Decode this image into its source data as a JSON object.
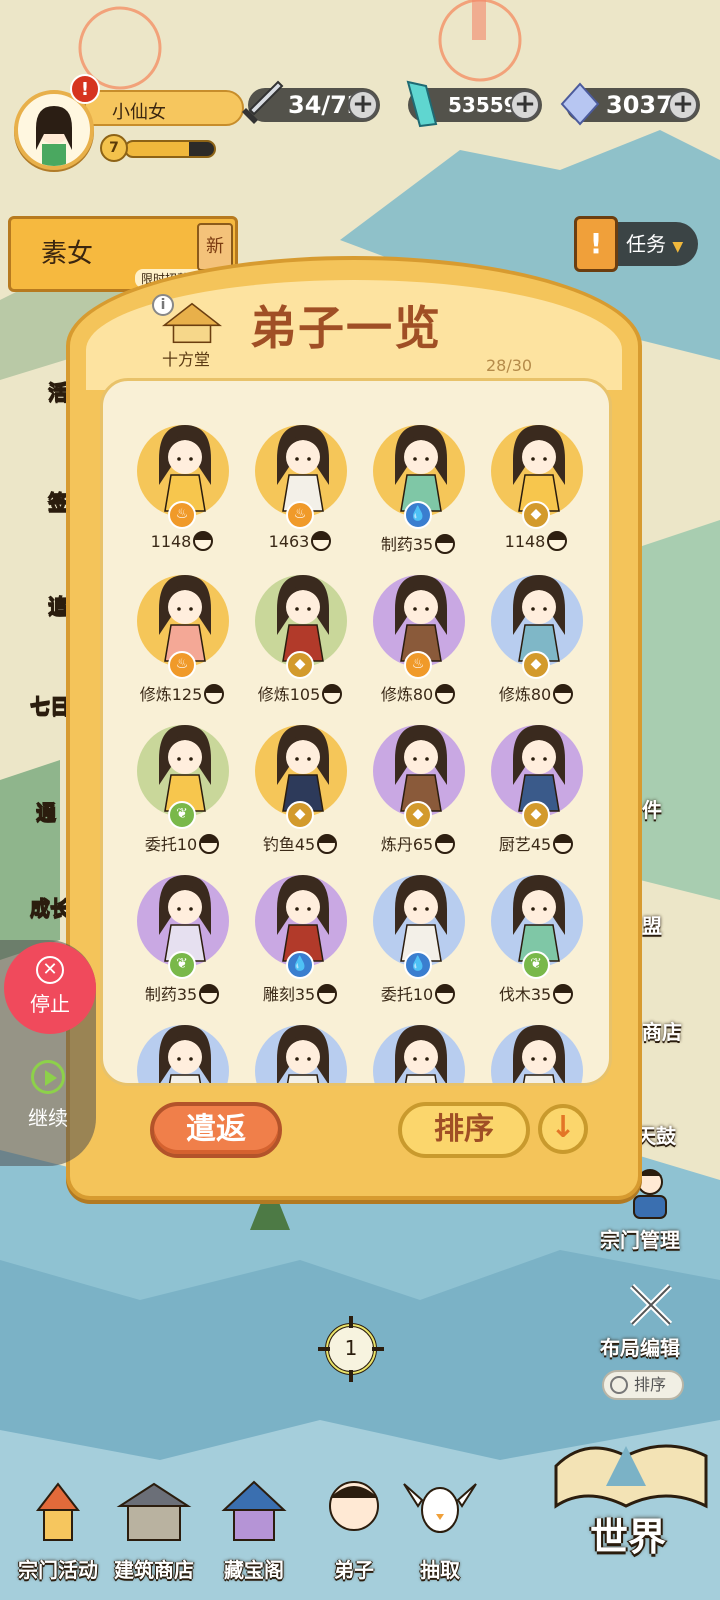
{
  "player": {
    "name": "小仙女",
    "level": "7",
    "exp_fraction": 0.72
  },
  "resources": [
    {
      "id": "stamina",
      "icon": "sword-icon",
      "value": "34/72"
    },
    {
      "id": "jade",
      "icon": "crystal-icon",
      "value": "535596"
    },
    {
      "id": "gem",
      "icon": "diamond-icon",
      "value": "3037"
    }
  ],
  "banner": {
    "title": "素女",
    "subtitle": "限时招募活动",
    "tag": "新"
  },
  "task": {
    "label": "任务"
  },
  "left_side_labels": [
    "活",
    "签",
    "追",
    "七日",
    "通",
    "成长"
  ],
  "panel": {
    "hall_label": "十方堂",
    "title": "弟子一览",
    "count": "28/30",
    "dismiss_label": "遣返",
    "sort_label": "排序"
  },
  "disciples": [
    {
      "label": "1148",
      "bg": "#f5c659",
      "elem": "fire",
      "elem_color": "#f09a2a",
      "robe": "#f7c64d"
    },
    {
      "label": "1463",
      "bg": "#f5c659",
      "elem": "fire",
      "elem_color": "#f09a2a",
      "robe": "#f3f0e8"
    },
    {
      "label": "制药35",
      "bg": "#f5c659",
      "elem": "water",
      "elem_color": "#3a7ecf",
      "robe": "#7fc7a6"
    },
    {
      "label": "1148",
      "bg": "#f5c659",
      "elem": "earth",
      "elem_color": "#d39a2c",
      "robe": "#f7c64d"
    },
    {
      "label": "修炼125",
      "bg": "#f5c659",
      "elem": "fire",
      "elem_color": "#f09a2a",
      "robe": "#f4a896"
    },
    {
      "label": "修炼105",
      "bg": "#c9d79a",
      "elem": "earth",
      "elem_color": "#d39a2c",
      "robe": "#b23a2a"
    },
    {
      "label": "修炼80",
      "bg": "#c9a8e3",
      "elem": "fire",
      "elem_color": "#f09a2a",
      "robe": "#8a5a3a"
    },
    {
      "label": "修炼80",
      "bg": "#b8cdef",
      "elem": "earth",
      "elem_color": "#d39a2c",
      "robe": "#7fb7c7"
    },
    {
      "label": "委托10",
      "bg": "#c9d79a",
      "elem": "wood",
      "elem_color": "#79b84a",
      "robe": "#f7c64d"
    },
    {
      "label": "钓鱼45",
      "bg": "#f5c659",
      "elem": "earth",
      "elem_color": "#d39a2c",
      "robe": "#2d3a5a"
    },
    {
      "label": "炼丹65",
      "bg": "#c9a8e3",
      "elem": "earth",
      "elem_color": "#d39a2c",
      "robe": "#8a5a3a"
    },
    {
      "label": "厨艺45",
      "bg": "#c9a8e3",
      "elem": "earth",
      "elem_color": "#d39a2c",
      "robe": "#3a5a8a"
    },
    {
      "label": "制药35",
      "bg": "#c9a8e3",
      "elem": "wood",
      "elem_color": "#79b84a",
      "robe": "#e6e0f0"
    },
    {
      "label": "雕刻35",
      "bg": "#c9a8e3",
      "elem": "water",
      "elem_color": "#3a7ecf",
      "robe": "#b23a2a"
    },
    {
      "label": "委托10",
      "bg": "#b8cdef",
      "elem": "water",
      "elem_color": "#3a7ecf",
      "robe": "#f3f0e8"
    },
    {
      "label": "伐木35",
      "bg": "#b8cdef",
      "elem": "wood",
      "elem_color": "#79b84a",
      "robe": "#7fc7a6"
    },
    {
      "label": "",
      "bg": "#b8cdef",
      "elem": "",
      "elem_color": "",
      "robe": "#f3f0e8"
    },
    {
      "label": "",
      "bg": "#b8cdef",
      "elem": "",
      "elem_color": "",
      "robe": "#f3f0e8"
    },
    {
      "label": "",
      "bg": "#b8cdef",
      "elem": "",
      "elem_color": "",
      "robe": "#f3f0e8"
    },
    {
      "label": "",
      "bg": "#b8cdef",
      "elem": "",
      "elem_color": "",
      "robe": "#f3f0e8"
    }
  ],
  "floating_controls": {
    "stop_label": "停止",
    "continue_label": "继续"
  },
  "right_menu": {
    "item1": "件",
    "item2": "盟",
    "shop": "商店",
    "drum": "天鼓",
    "sect_manage": "宗门管理",
    "layout_edit": "布局编辑",
    "layout_sort": "排序"
  },
  "locator_number": "1",
  "bottom_nav": [
    {
      "label": "宗门活动"
    },
    {
      "label": "建筑商店"
    },
    {
      "label": "藏宝阁"
    },
    {
      "label": "弟子"
    },
    {
      "label": "抽取"
    }
  ],
  "world_label": "世界",
  "colors": {
    "panel": "#f4c45a",
    "title": "#a04f25",
    "dismiss": "#f07f4a",
    "stop": "#f04a5c"
  }
}
